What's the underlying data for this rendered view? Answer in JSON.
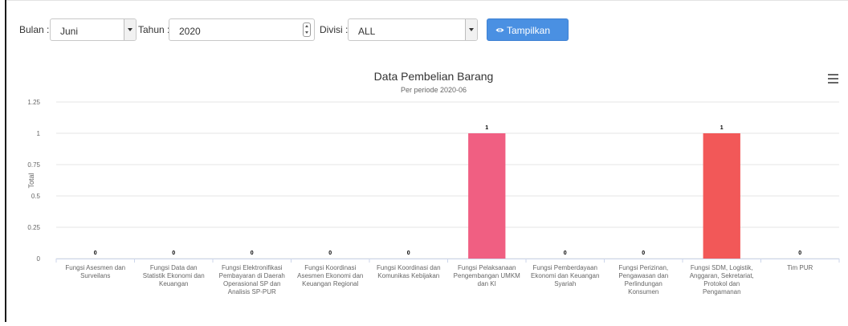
{
  "filters": {
    "month_label": "Bulan :",
    "month_value": "Juni",
    "year_label": "Tahun :",
    "year_value": "2020",
    "division_label": "Divisi :",
    "division_value": "ALL",
    "show_button": "Tampilkan"
  },
  "icons": {
    "show_button_icon": "eye-icon",
    "chart_menu_icon": "hamburger-menu-icon"
  },
  "colors": {
    "button": "#4a90e2",
    "bar_pink": "#f05f82",
    "bar_red": "#f25858"
  },
  "chart_data": {
    "type": "bar",
    "title": "Data Pembelian Barang",
    "subtitle": "Per periode 2020-06",
    "ylabel": "Total",
    "xlabel": "",
    "ylim": [
      0,
      1.25
    ],
    "yticks": [
      "0",
      "0.25",
      "0.5",
      "0.75",
      "1",
      "1.25"
    ],
    "grid": true,
    "categories": [
      "Fungsi Asesmen dan Surveilans",
      "Fungsi Data dan Statistik Ekonomi dan Keuangan",
      "Fungsi Elektronifikasi Pembayaran di Daerah Operasional SP dan Analisis SP-PUR",
      "Fungsi Koordinasi Asesmen Ekonomi dan Keuangan Regional",
      "Fungsi Koordinasi dan Komunikas Kebijakan",
      "Fungsi Pelaksanaan Pengembangan UMKM dan KI",
      "Fungsi Pemberdayaan Ekonomi dan Keuangan Syariah",
      "Fungsi Perizinan, Pengawasan dan Perlindungan Konsumen",
      "Fungsi SDM, Logistik, Anggaran, Sekretariat, Protokol dan Pengamanan",
      "Tim PUR"
    ],
    "category_lines": [
      [
        "Fungsi Asesmen dan",
        "Surveilans"
      ],
      [
        "Fungsi Data dan",
        "Statistik Ekonomi dan",
        "Keuangan"
      ],
      [
        "Fungsi Elektronifikasi",
        "Pembayaran di Daerah",
        "Operasional SP dan",
        "Analisis SP-PUR"
      ],
      [
        "Fungsi Koordinasi",
        "Asesmen Ekonomi dan",
        "Keuangan Regional"
      ],
      [
        "Fungsi Koordinasi dan",
        "Komunikas Kebijakan"
      ],
      [
        "Fungsi Pelaksanaan",
        "Pengembangan UMKM",
        "dan KI"
      ],
      [
        "Fungsi Pemberdayaan",
        "Ekonomi dan Keuangan",
        "Syariah"
      ],
      [
        "Fungsi Perizinan,",
        "Pengawasan dan",
        "Perlindungan",
        "Konsumen"
      ],
      [
        "Fungsi SDM, Logistik,",
        "Anggaran, Sekretariat,",
        "Protokol dan",
        "Pengamanan"
      ],
      [
        "Tim PUR"
      ]
    ],
    "values": [
      0,
      0,
      0,
      0,
      0,
      1,
      0,
      0,
      1,
      0
    ],
    "bar_colors": [
      "#f05f82",
      "#f05f82",
      "#f05f82",
      "#f05f82",
      "#f05f82",
      "#f05f82",
      "#f25858",
      "#f25858",
      "#f25858",
      "#f25858"
    ],
    "data_labels": [
      "0",
      "0",
      "0",
      "0",
      "0",
      "1",
      "0",
      "0",
      "1",
      "0"
    ],
    "legend": "none"
  }
}
